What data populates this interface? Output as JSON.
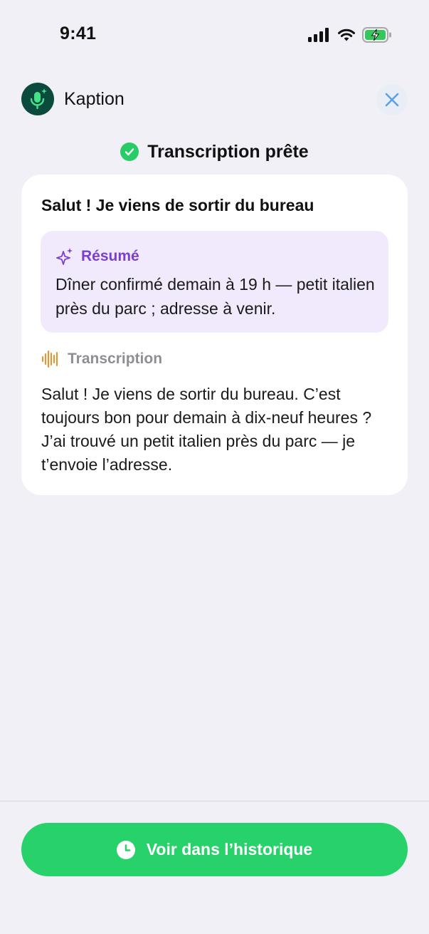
{
  "status_bar": {
    "time": "9:41",
    "icons": [
      "cellular-signal-icon",
      "wifi-icon",
      "battery-charging-icon"
    ]
  },
  "header": {
    "app_name": "Kaption",
    "logo_icon": "microphone-sparkle-icon",
    "close_icon": "close-icon"
  },
  "status": {
    "text": "Transcription prête",
    "icon": "checkmark-circle-icon",
    "color": "#27CC66"
  },
  "message": {
    "title": "Salut ! Je viens de sortir du bureau",
    "summary": {
      "label": "Résumé",
      "icon": "sparkles-icon",
      "text": "Dîner confirmé demain à 19 h — petit italien près du parc ; adresse à venir.",
      "accent": "#7A3FD0"
    },
    "transcription": {
      "label": "Transcription",
      "icon": "waveform-icon",
      "text": "Salut ! Je viens de sortir du bureau. C’est toujours bon pour demain à dix-neuf heures ? J’ai trouvé un petit italien près du parc — je t’envoie l’adresse.",
      "accent": "#F0902A"
    }
  },
  "footer": {
    "history_button": "Voir dans l’historique",
    "history_icon": "clock-icon",
    "button_color": "#28D26A"
  }
}
